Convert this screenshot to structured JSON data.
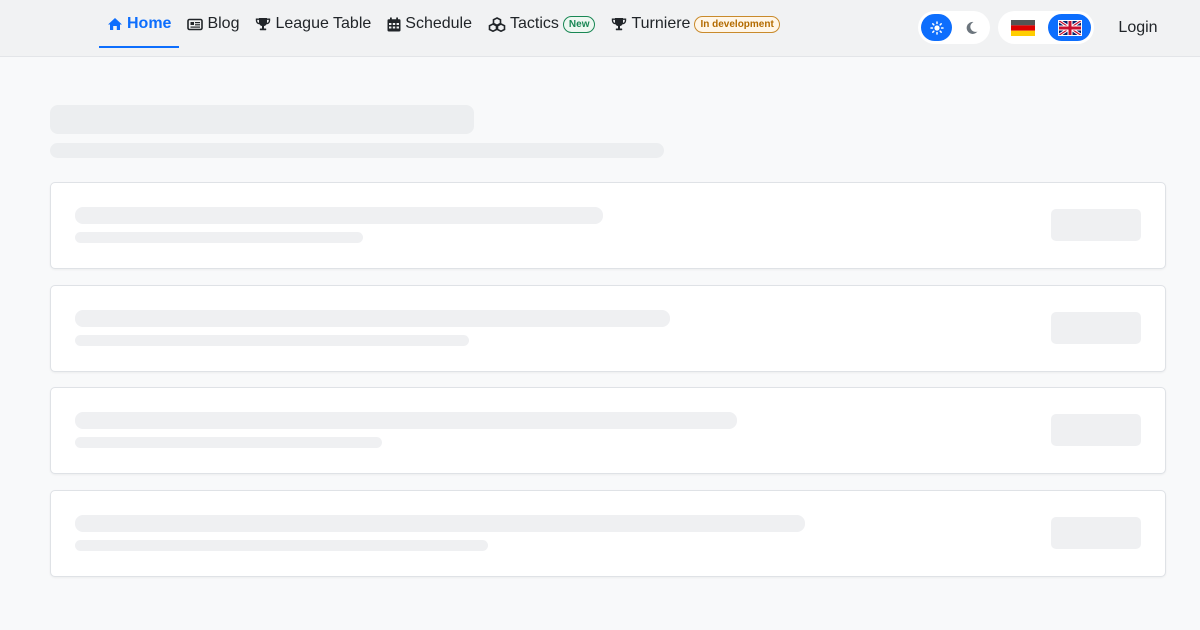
{
  "nav": {
    "items": [
      {
        "label": "Home",
        "icon": "home-icon",
        "active": true
      },
      {
        "label": "Blog",
        "icon": "newspaper-icon"
      },
      {
        "label": "League Table",
        "icon": "trophy-icon"
      },
      {
        "label": "Schedule",
        "icon": "calendar-icon"
      },
      {
        "label": "Tactics",
        "icon": "cubes-icon",
        "badge": "New"
      },
      {
        "label": "Turniere",
        "icon": "trophy-icon",
        "badge": "In development"
      }
    ]
  },
  "theme_toggle": {
    "options": [
      "light",
      "dark"
    ],
    "selected": "light"
  },
  "language_toggle": {
    "options": [
      "de",
      "en"
    ],
    "selected": "en"
  },
  "login_label": "Login",
  "colors": {
    "accent": "#0d6efd",
    "new_badge": "#198754",
    "dev_badge": "#b36b00",
    "skeleton": "#eceef0"
  },
  "loading": {
    "state": "skeleton",
    "card_count": 4
  }
}
